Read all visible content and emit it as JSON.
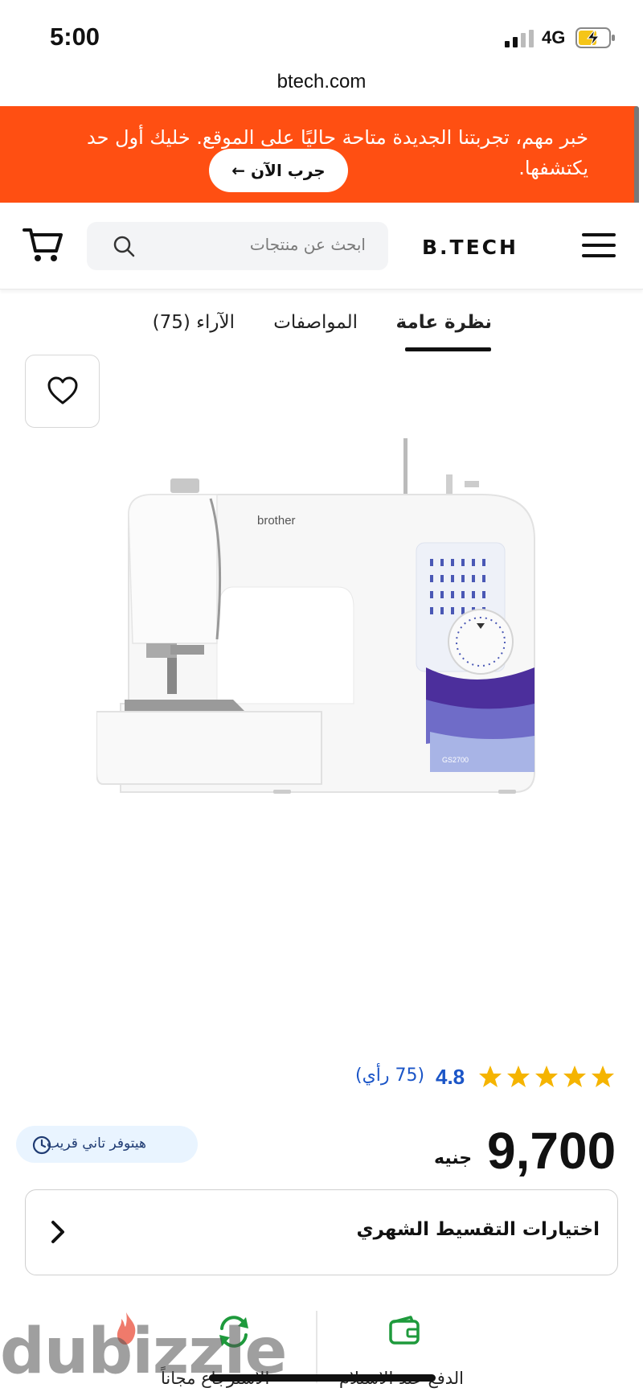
{
  "status_bar": {
    "time": "5:00",
    "network": "4G"
  },
  "browser": {
    "url": "btech.com"
  },
  "banner": {
    "message": "خبر مهم، تجربتنا الجديدة متاحة حاليًا على الموقع. خليك أول حد يكتشفها.",
    "cta_label": "جرب الآن ←"
  },
  "header": {
    "logo": "B.TECH",
    "search_placeholder": "ابحث عن منتجات"
  },
  "tabs": [
    {
      "label": "نظرة عامة",
      "active": true
    },
    {
      "label": "المواصفات",
      "active": false
    },
    {
      "label": "الآراء (75)",
      "active": false
    }
  ],
  "product": {
    "image_brand_text": "brother",
    "image_model_text": "GS2700",
    "rating": {
      "stars": 5,
      "average": "4.8",
      "count_label": "(75 رأي)"
    },
    "price": "9,700",
    "currency": "جنيه",
    "availability": "هيتوفر تاني قريب"
  },
  "installment": {
    "label": "اختيارات التقسيط الشهري"
  },
  "features": [
    {
      "label": "الدفع عند الاستلام",
      "icon": "wallet-icon"
    },
    {
      "label": "الاسترجاع مجاناً",
      "icon": "return-icon"
    }
  ],
  "watermark": "dubizzle",
  "colors": {
    "brand_orange": "#FF4F12",
    "link_blue": "#1b55c7",
    "star_yellow": "#F5B400",
    "feature_green": "#1e9a3c"
  }
}
